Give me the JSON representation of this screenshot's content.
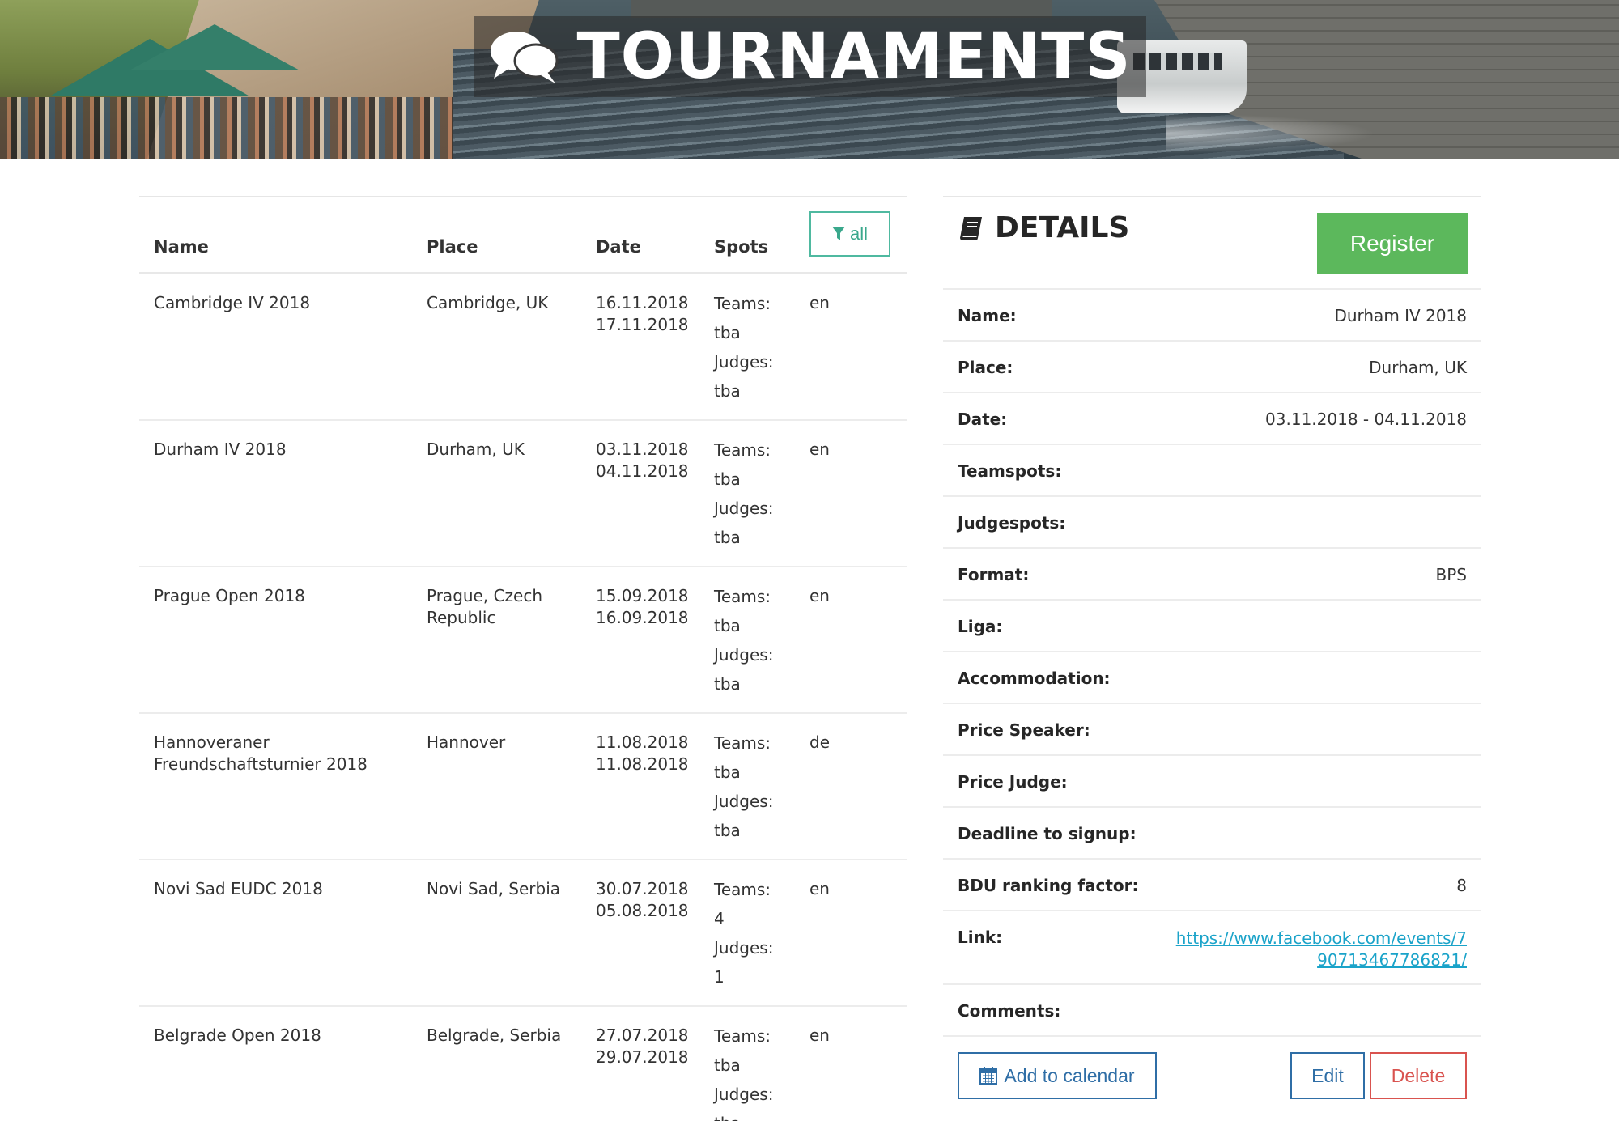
{
  "hero": {
    "title": "TOURNAMENTS",
    "icon": "comments-icon"
  },
  "table": {
    "headers": {
      "name": "Name",
      "place": "Place",
      "date": "Date",
      "spots": "Spots"
    },
    "filter_label": "all",
    "filter_icon": "filter-icon",
    "rows": [
      {
        "name": "Cambridge IV 2018",
        "place": "Cambridge, UK",
        "date_start": "16.11.2018",
        "date_end": "17.11.2018",
        "teams_label": "Teams:",
        "teams": "tba",
        "judges_label": "Judges:",
        "judges": "tba",
        "lang": "en"
      },
      {
        "name": "Durham IV 2018",
        "place": "Durham, UK",
        "date_start": "03.11.2018",
        "date_end": "04.11.2018",
        "teams_label": "Teams:",
        "teams": "tba",
        "judges_label": "Judges:",
        "judges": "tba",
        "lang": "en"
      },
      {
        "name": "Prague Open 2018",
        "place": "Prague, Czech Republic",
        "date_start": "15.09.2018",
        "date_end": "16.09.2018",
        "teams_label": "Teams:",
        "teams": "tba",
        "judges_label": "Judges:",
        "judges": "tba",
        "lang": "en"
      },
      {
        "name": "Hannoveraner Freundschaftsturnier 2018",
        "place": "Hannover",
        "date_start": "11.08.2018",
        "date_end": "11.08.2018",
        "teams_label": "Teams:",
        "teams": "tba",
        "judges_label": "Judges:",
        "judges": "tba",
        "lang": "de"
      },
      {
        "name": "Novi Sad EUDC 2018",
        "place": "Novi Sad, Serbia",
        "date_start": "30.07.2018",
        "date_end": "05.08.2018",
        "teams_label": "Teams:",
        "teams": "4",
        "judges_label": "Judges:",
        "judges": "1",
        "lang": "en"
      },
      {
        "name": "Belgrade Open 2018",
        "place": "Belgrade, Serbia",
        "date_start": "27.07.2018",
        "date_end": "29.07.2018",
        "teams_label": "Teams:",
        "teams": "tba",
        "judges_label": "Judges:",
        "judges": "tba",
        "lang": "en"
      }
    ]
  },
  "details": {
    "title": "DETAILS",
    "icon": "book-icon",
    "register_label": "Register",
    "fields": [
      {
        "label": "Name:",
        "value": "Durham IV 2018"
      },
      {
        "label": "Place:",
        "value": "Durham, UK"
      },
      {
        "label": "Date:",
        "value": "03.11.2018 - 04.11.2018"
      },
      {
        "label": "Teamspots:",
        "value": ""
      },
      {
        "label": "Judgespots:",
        "value": ""
      },
      {
        "label": "Format:",
        "value": "BPS"
      },
      {
        "label": "Liga:",
        "value": ""
      },
      {
        "label": "Accommodation:",
        "value": ""
      },
      {
        "label": "Price Speaker:",
        "value": ""
      },
      {
        "label": "Price Judge:",
        "value": ""
      },
      {
        "label": "Deadline to signup:",
        "value": ""
      },
      {
        "label": "BDU ranking factor:",
        "value": "8"
      },
      {
        "label": "Link:",
        "value": "https://www.facebook.com/events/790713467786821/"
      },
      {
        "label": "Comments:",
        "value": ""
      }
    ],
    "actions": {
      "calendar_label": "Add to calendar",
      "calendar_icon": "calendar-icon",
      "edit_label": "Edit",
      "delete_label": "Delete"
    }
  },
  "colors": {
    "accent_teal": "#4fb9a0",
    "register_green": "#5cb85c",
    "primary_blue": "#2f6ea6",
    "danger_red": "#d9534f",
    "link_blue": "#1aa3c9"
  }
}
